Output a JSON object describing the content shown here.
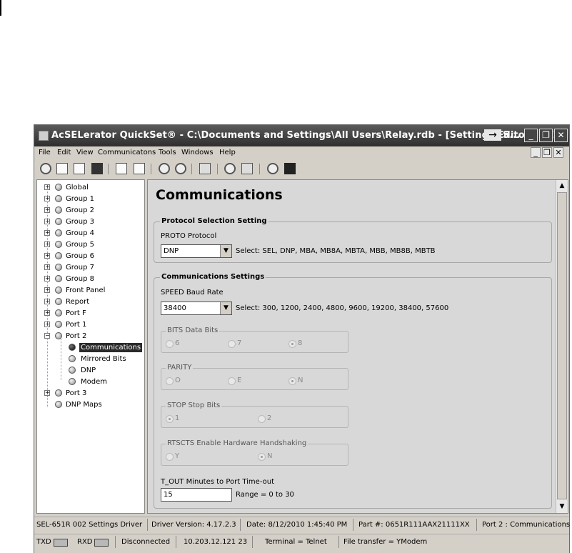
{
  "window": {
    "title": "AcSELerator QuickSet® - C:\\Documents and Settings\\All Users\\Relay.rdb - [Settings Editor - 651R D",
    "title_arrow": "→",
    "title_tail": "S...",
    "controls": {
      "minimize": "_",
      "restore": "❐",
      "close": "✕"
    }
  },
  "menu": [
    "File",
    "Edit",
    "View",
    "Communicatons",
    "Tools",
    "Windows",
    "Help"
  ],
  "mdi_controls": {
    "minimize": "_",
    "restore": "❐",
    "close": "✕"
  },
  "tree": {
    "items": [
      {
        "label": "Global",
        "level": 0,
        "expander": "+"
      },
      {
        "label": "Group 1",
        "level": 0,
        "expander": "+"
      },
      {
        "label": "Group 2",
        "level": 0,
        "expander": "+"
      },
      {
        "label": "Group 3",
        "level": 0,
        "expander": "+"
      },
      {
        "label": "Group 4",
        "level": 0,
        "expander": "+"
      },
      {
        "label": "Group 5",
        "level": 0,
        "expander": "+"
      },
      {
        "label": "Group 6",
        "level": 0,
        "expander": "+"
      },
      {
        "label": "Group 7",
        "level": 0,
        "expander": "+"
      },
      {
        "label": "Group 8",
        "level": 0,
        "expander": "+"
      },
      {
        "label": "Front Panel",
        "level": 0,
        "expander": "+"
      },
      {
        "label": "Report",
        "level": 0,
        "expander": "+"
      },
      {
        "label": "Port F",
        "level": 0,
        "expander": "+"
      },
      {
        "label": "Port 1",
        "level": 0,
        "expander": "+"
      },
      {
        "label": "Port 2",
        "level": 0,
        "expander": "−"
      },
      {
        "label": "Communications",
        "level": 1,
        "selected": true
      },
      {
        "label": "Mirrored Bits",
        "level": 1
      },
      {
        "label": "DNP",
        "level": 1
      },
      {
        "label": "Modem",
        "level": 1
      },
      {
        "label": "Port 3",
        "level": 0,
        "expander": "+"
      },
      {
        "label": "DNP Maps",
        "level": 0
      }
    ]
  },
  "main": {
    "title": "Communications",
    "protocol": {
      "heading": "Protocol Selection Setting",
      "label": "PROTO  Protocol",
      "value": "DNP",
      "select_text": "Select: SEL, DNP, MBA, MB8A, MBTA, MBB, MB8B, MBTB"
    },
    "comms": {
      "heading": "Communications Settings",
      "speed_label": "SPEED  Baud Rate",
      "speed_value": "38400",
      "speed_select_text": "Select: 300, 1200, 2400, 4800, 9600, 19200, 38400, 57600",
      "bits": {
        "label": "BITS Data Bits",
        "options": [
          "6",
          "7",
          "8"
        ],
        "selected": "8"
      },
      "parity": {
        "label": "PARITY",
        "options": [
          "O",
          "E",
          "N"
        ],
        "selected": "N"
      },
      "stop": {
        "label": "STOP Stop Bits",
        "options": [
          "1",
          "2"
        ],
        "selected": "1"
      },
      "rtscts": {
        "label": "RTSCTS Enable Hardware Handshaking",
        "options": [
          "Y",
          "N"
        ],
        "selected": "N"
      },
      "tout_label": "T_OUT  Minutes to Port Time-out",
      "tout_value": "15",
      "tout_range": "Range = 0 to 30"
    }
  },
  "status": {
    "driver": "SEL-651R 002 Settings Driver",
    "version": "Driver Version: 4.17.2.3",
    "date": "Date: 8/12/2010 1:45:40 PM",
    "part": "Part #: 0651R111AAX21111XX",
    "location": "Port 2 : Communications"
  },
  "status2": {
    "txd": "TXD",
    "rxd": "RXD",
    "connection": "Disconnected",
    "address": "10.203.12.121  23",
    "terminal": "Terminal = Telnet",
    "transfer": "File transfer = YModem"
  }
}
